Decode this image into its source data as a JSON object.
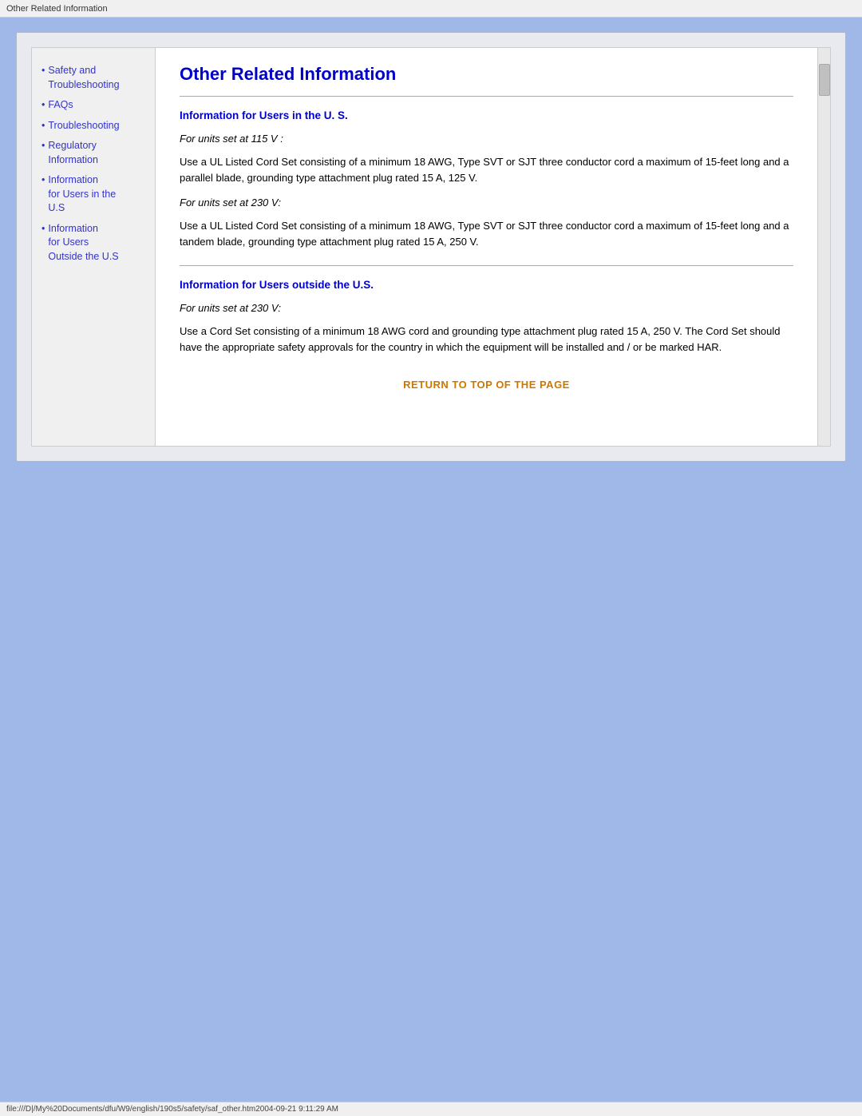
{
  "title_bar": {
    "text": "Other Related Information"
  },
  "sidebar": {
    "items": [
      {
        "id": "safety-troubleshooting",
        "label_line1": "Safety and",
        "label_line2": "Troubleshooting",
        "multiline": true
      },
      {
        "id": "faqs",
        "label": "FAQs",
        "multiline": false
      },
      {
        "id": "troubleshooting",
        "label": "Troubleshooting",
        "multiline": false
      },
      {
        "id": "regulatory-info",
        "label_line1": "Regulatory",
        "label_line2": "Information",
        "multiline": true
      },
      {
        "id": "info-users-us",
        "label_line1": "Information",
        "label_line2": "for Users in the",
        "label_line3": "U.S",
        "multiline": true
      },
      {
        "id": "info-users-outside",
        "label_line1": "Information",
        "label_line2": "for Users",
        "label_line3": "Outside the U.S",
        "multiline": true
      }
    ]
  },
  "main": {
    "page_title": "Other Related Information",
    "section1": {
      "heading": "Information for Users in the U. S.",
      "subsection1": {
        "label": "For units set at 115 V :",
        "body": "Use a UL Listed Cord Set consisting of a minimum 18 AWG, Type SVT or SJT three conductor cord a maximum of 15-feet long and a parallel blade, grounding type attachment plug rated 15 A, 125 V."
      },
      "subsection2": {
        "label": "For units set at 230 V:",
        "body": "Use a UL Listed Cord Set consisting of a minimum 18 AWG, Type SVT or SJT three conductor cord a maximum of 15-feet long and a tandem blade, grounding type attachment plug rated 15 A, 250 V."
      }
    },
    "section2": {
      "heading": "Information for Users outside the U.S.",
      "subsection1": {
        "label": "For units set at 230 V:",
        "body": "Use a Cord Set consisting of a minimum 18 AWG cord and grounding type attachment plug rated 15 A, 250 V. The Cord Set should have the appropriate safety approvals for the country in which the equipment will be installed and / or be marked HAR."
      }
    },
    "return_link": "RETURN TO TOP OF THE PAGE"
  },
  "status_bar": {
    "text": "file:///D|/My%20Documents/dfu/W9/english/190s5/safety/saf_other.htm2004-09-21  9:11:29 AM"
  }
}
